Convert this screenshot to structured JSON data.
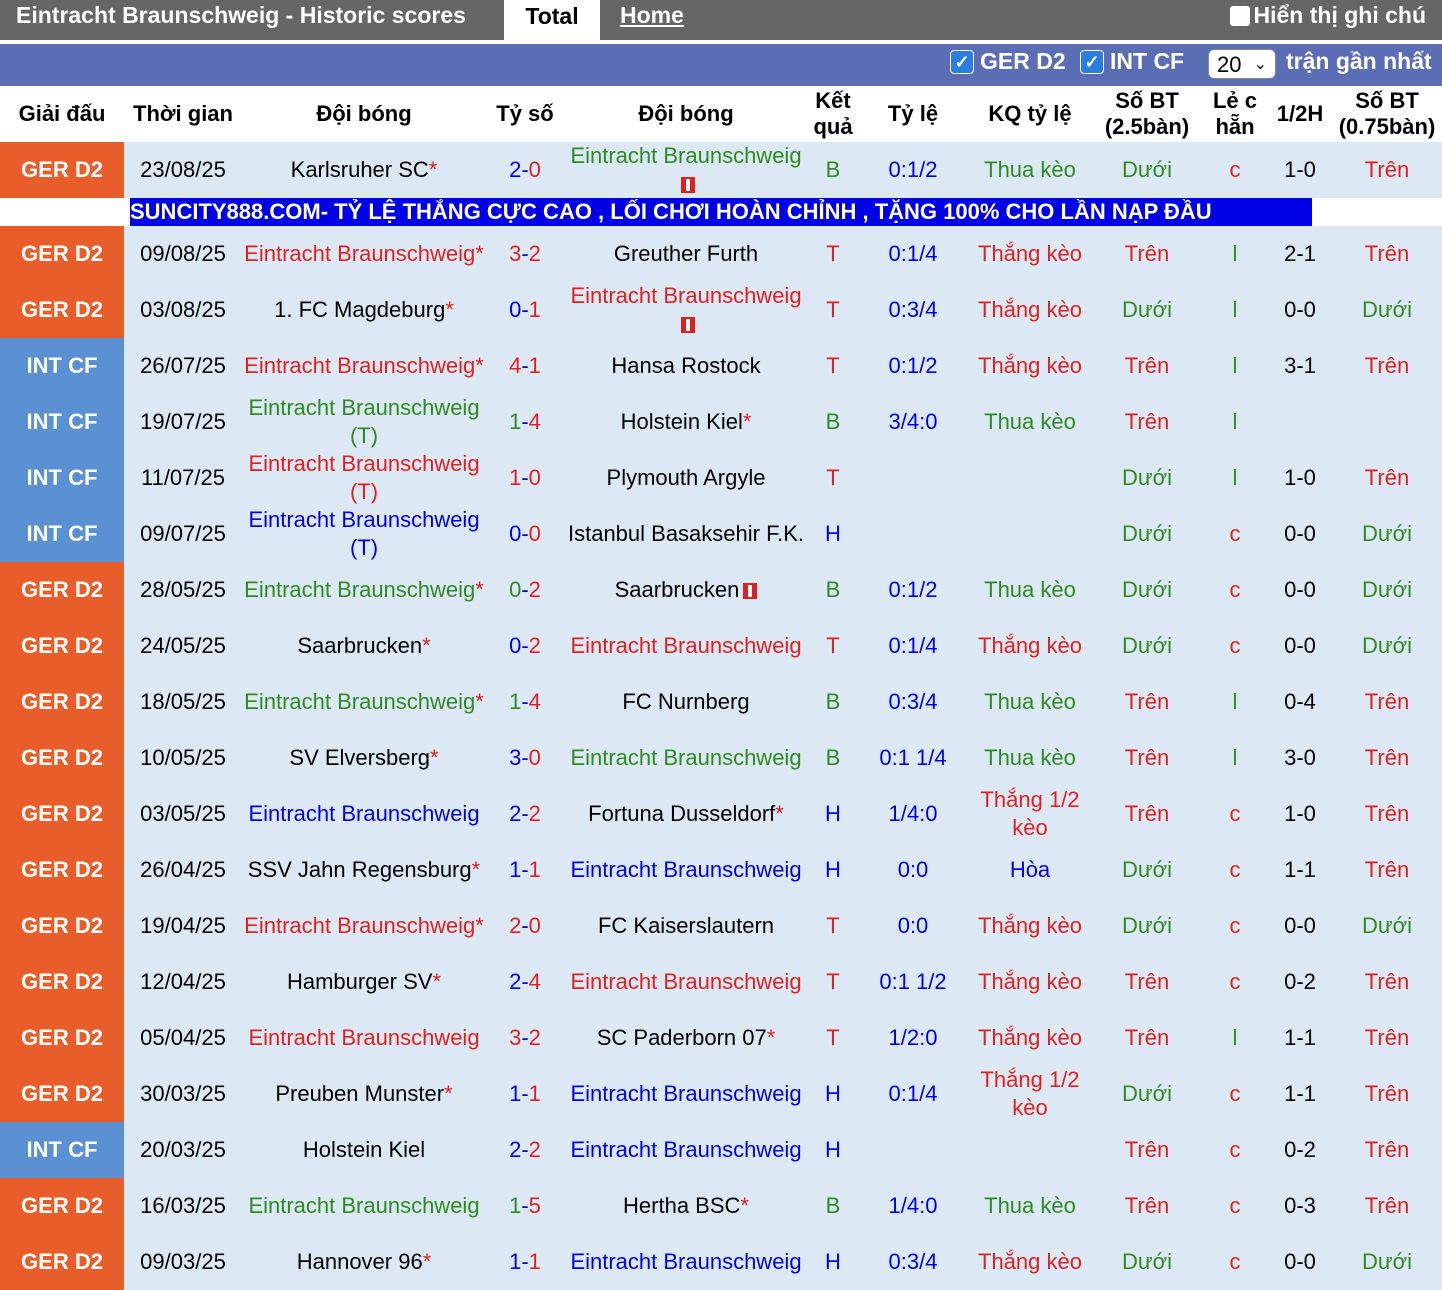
{
  "header": {
    "title": "Eintracht Braunschweig - Historic scores",
    "tab_total": "Total",
    "tab_home": "Home",
    "show_notes": "Hiển thị ghi chú"
  },
  "filters": {
    "league1": "GER D2",
    "league2": "INT CF",
    "count_value": "20",
    "recent_label": "trận gần nhất"
  },
  "columns": [
    "Giải đấu",
    "Thời gian",
    "Đội bóng",
    "Tỷ số",
    "Đội bóng",
    "Kết quả",
    "Tỷ lệ",
    "KQ tỷ lệ",
    "Số BT (2.5bàn)",
    "Lẻ c hẵn",
    "1/2H",
    "Số BT (0.75bàn)"
  ],
  "ad_text": "SUNCITY888.COM- TỶ LỆ THẮNG CỰC CAO , LỐI CHƠI HOÀN CHỈNH , TẶNG 100% CHO LẦN NẠP ĐẦU",
  "rows": [
    {
      "league": "GER D2",
      "date": "23/08/25",
      "home": "Karlsruher SC",
      "home_suffix": "*",
      "home_color": "black",
      "score1": "2",
      "score2": "0",
      "away": "Eintracht Braunschweig",
      "away_suffix": "",
      "away_color": "green",
      "away_flag": true,
      "result": "B",
      "odds": "0:1/2",
      "odds_result": "Thua kèo",
      "ou": "Dưới",
      "oe": "c",
      "half": "1-0",
      "ou2": "Trên"
    },
    {
      "league": "GER D2",
      "date": "09/08/25",
      "home": "Eintracht Braunschweig",
      "home_suffix": "*",
      "home_color": "red",
      "score1": "3",
      "score2": "2",
      "away": "Greuther Furth",
      "away_suffix": "",
      "away_color": "black",
      "result": "T",
      "odds": "0:1/4",
      "odds_result": "Thắng kèo",
      "ou": "Trên",
      "oe": "l",
      "half": "2-1",
      "ou2": "Trên"
    },
    {
      "league": "GER D2",
      "date": "03/08/25",
      "home": "1. FC Magdeburg",
      "home_suffix": "*",
      "home_color": "black",
      "score1": "0",
      "score2": "1",
      "away": "Eintracht Braunschweig",
      "away_suffix": "",
      "away_color": "red",
      "away_flag": true,
      "result": "T",
      "odds": "0:3/4",
      "odds_result": "Thắng kèo",
      "ou": "Dưới",
      "oe": "l",
      "half": "0-0",
      "ou2": "Dưới"
    },
    {
      "league": "INT CF",
      "date": "26/07/25",
      "home": "Eintracht Braunschweig",
      "home_suffix": "*",
      "home_color": "red",
      "score1": "4",
      "score2": "1",
      "away": "Hansa Rostock",
      "away_suffix": "",
      "away_color": "black",
      "result": "T",
      "odds": "0:1/2",
      "odds_result": "Thắng kèo",
      "ou": "Trên",
      "oe": "l",
      "half": "3-1",
      "ou2": "Trên"
    },
    {
      "league": "INT CF",
      "date": "19/07/25",
      "home": "Eintracht Braunschweig",
      "home_suffix": "(T)",
      "home_color": "green",
      "score1": "1",
      "score2": "4",
      "away": "Holstein Kiel",
      "away_suffix": "*",
      "away_color": "black",
      "result": "B",
      "odds": "3/4:0",
      "odds_result": "Thua kèo",
      "ou": "Trên",
      "oe": "l",
      "half": "",
      "ou2": ""
    },
    {
      "league": "INT CF",
      "date": "11/07/25",
      "home": "Eintracht Braunschweig",
      "home_suffix": "(T)",
      "home_color": "red",
      "score1": "1",
      "score2": "0",
      "away": "Plymouth Argyle",
      "away_suffix": "",
      "away_color": "black",
      "result": "T",
      "odds": "",
      "odds_result": "",
      "ou": "Dưới",
      "oe": "l",
      "half": "1-0",
      "ou2": "Trên"
    },
    {
      "league": "INT CF",
      "date": "09/07/25",
      "home": "Eintracht Braunschweig",
      "home_suffix": "(T)",
      "home_color": "blue",
      "score1": "0",
      "score2": "0",
      "away": "Istanbul Basaksehir F.K.",
      "away_suffix": "",
      "away_color": "black",
      "result": "H",
      "odds": "",
      "odds_result": "",
      "ou": "Dưới",
      "oe": "c",
      "half": "0-0",
      "ou2": "Dưới"
    },
    {
      "league": "GER D2",
      "date": "28/05/25",
      "home": "Eintracht Braunschweig",
      "home_suffix": "*",
      "home_color": "green",
      "score1": "0",
      "score2": "2",
      "away": "Saarbrucken",
      "away_suffix": "",
      "away_color": "black",
      "away_flag": true,
      "result": "B",
      "odds": "0:1/2",
      "odds_result": "Thua kèo",
      "ou": "Dưới",
      "oe": "c",
      "half": "0-0",
      "ou2": "Dưới"
    },
    {
      "league": "GER D2",
      "date": "24/05/25",
      "home": "Saarbrucken",
      "home_suffix": "*",
      "home_color": "black",
      "score1": "0",
      "score2": "2",
      "away": "Eintracht Braunschweig",
      "away_suffix": "",
      "away_color": "red",
      "result": "T",
      "odds": "0:1/4",
      "odds_result": "Thắng kèo",
      "ou": "Dưới",
      "oe": "c",
      "half": "0-0",
      "ou2": "Dưới"
    },
    {
      "league": "GER D2",
      "date": "18/05/25",
      "home": "Eintracht Braunschweig",
      "home_suffix": "*",
      "home_color": "green",
      "score1": "1",
      "score2": "4",
      "away": "FC Nurnberg",
      "away_suffix": "",
      "away_color": "black",
      "result": "B",
      "odds": "0:3/4",
      "odds_result": "Thua kèo",
      "ou": "Trên",
      "oe": "l",
      "half": "0-4",
      "ou2": "Trên"
    },
    {
      "league": "GER D2",
      "date": "10/05/25",
      "home": "SV Elversberg",
      "home_suffix": "*",
      "home_color": "black",
      "score1": "3",
      "score2": "0",
      "away": "Eintracht Braunschweig",
      "away_suffix": "",
      "away_color": "green",
      "result": "B",
      "odds": "0:1 1/4",
      "odds_result": "Thua kèo",
      "ou": "Trên",
      "oe": "l",
      "half": "3-0",
      "ou2": "Trên"
    },
    {
      "league": "GER D2",
      "date": "03/05/25",
      "home": "Eintracht Braunschweig",
      "home_suffix": "",
      "home_color": "blue",
      "score1": "2",
      "score2": "2",
      "away": "Fortuna Dusseldorf",
      "away_suffix": "*",
      "away_color": "black",
      "result": "H",
      "odds": "1/4:0",
      "odds_result": "Thắng 1/2 kèo",
      "ou": "Trên",
      "oe": "c",
      "half": "1-0",
      "ou2": "Trên"
    },
    {
      "league": "GER D2",
      "date": "26/04/25",
      "home": "SSV Jahn Regensburg",
      "home_suffix": "*",
      "home_color": "black",
      "score1": "1",
      "score2": "1",
      "away": "Eintracht Braunschweig",
      "away_suffix": "",
      "away_color": "blue",
      "result": "H",
      "odds": "0:0",
      "odds_result": "Hòa",
      "ou": "Dưới",
      "oe": "c",
      "half": "1-1",
      "ou2": "Trên"
    },
    {
      "league": "GER D2",
      "date": "19/04/25",
      "home": "Eintracht Braunschweig",
      "home_suffix": "*",
      "home_color": "red",
      "score1": "2",
      "score2": "0",
      "away": "FC Kaiserslautern",
      "away_suffix": "",
      "away_color": "black",
      "result": "T",
      "odds": "0:0",
      "odds_result": "Thắng kèo",
      "ou": "Dưới",
      "oe": "c",
      "half": "0-0",
      "ou2": "Dưới"
    },
    {
      "league": "GER D2",
      "date": "12/04/25",
      "home": "Hamburger SV",
      "home_suffix": "*",
      "home_color": "black",
      "score1": "2",
      "score2": "4",
      "away": "Eintracht Braunschweig",
      "away_suffix": "",
      "away_color": "red",
      "result": "T",
      "odds": "0:1 1/2",
      "odds_result": "Thắng kèo",
      "ou": "Trên",
      "oe": "c",
      "half": "0-2",
      "ou2": "Trên"
    },
    {
      "league": "GER D2",
      "date": "05/04/25",
      "home": "Eintracht Braunschweig",
      "home_suffix": "",
      "home_color": "red",
      "score1": "3",
      "score2": "2",
      "away": "SC Paderborn 07",
      "away_suffix": "*",
      "away_color": "black",
      "result": "T",
      "odds": "1/2:0",
      "odds_result": "Thắng kèo",
      "ou": "Trên",
      "oe": "l",
      "half": "1-1",
      "ou2": "Trên"
    },
    {
      "league": "GER D2",
      "date": "30/03/25",
      "home": "Preuben Munster",
      "home_suffix": "*",
      "home_color": "black",
      "score1": "1",
      "score2": "1",
      "away": "Eintracht Braunschweig",
      "away_suffix": "",
      "away_color": "blue",
      "result": "H",
      "odds": "0:1/4",
      "odds_result": "Thắng 1/2 kèo",
      "ou": "Dưới",
      "oe": "c",
      "half": "1-1",
      "ou2": "Trên"
    },
    {
      "league": "INT CF",
      "date": "20/03/25",
      "home": "Holstein Kiel",
      "home_suffix": "",
      "home_color": "black",
      "score1": "2",
      "score2": "2",
      "away": "Eintracht Braunschweig",
      "away_suffix": "",
      "away_color": "blue",
      "result": "H",
      "odds": "",
      "odds_result": "",
      "ou": "Trên",
      "oe": "c",
      "half": "0-2",
      "ou2": "Trên"
    },
    {
      "league": "GER D2",
      "date": "16/03/25",
      "home": "Eintracht Braunschweig",
      "home_suffix": "",
      "home_color": "green",
      "score1": "1",
      "score2": "5",
      "away": "Hertha BSC",
      "away_suffix": "*",
      "away_color": "black",
      "result": "B",
      "odds": "1/4:0",
      "odds_result": "Thua kèo",
      "ou": "Trên",
      "oe": "c",
      "half": "0-3",
      "ou2": "Trên"
    },
    {
      "league": "GER D2",
      "date": "09/03/25",
      "home": "Hannover 96",
      "home_suffix": "*",
      "home_color": "black",
      "score1": "1",
      "score2": "1",
      "away": "Eintracht Braunschweig",
      "away_suffix": "",
      "away_color": "blue",
      "result": "H",
      "odds": "0:3/4",
      "odds_result": "Thắng kèo",
      "ou": "Dưới",
      "oe": "c",
      "half": "0-0",
      "ou2": "Dưới"
    }
  ],
  "colors": {
    "win": "#e02020",
    "loss": "#2e8b22",
    "draw": "#0000e6",
    "league_gd2": "#e85d2a",
    "league_intcf": "#5a91d2",
    "row_bg": "#dce9f5",
    "filter_bar": "#5b6eb5",
    "title_bar": "#666666"
  }
}
